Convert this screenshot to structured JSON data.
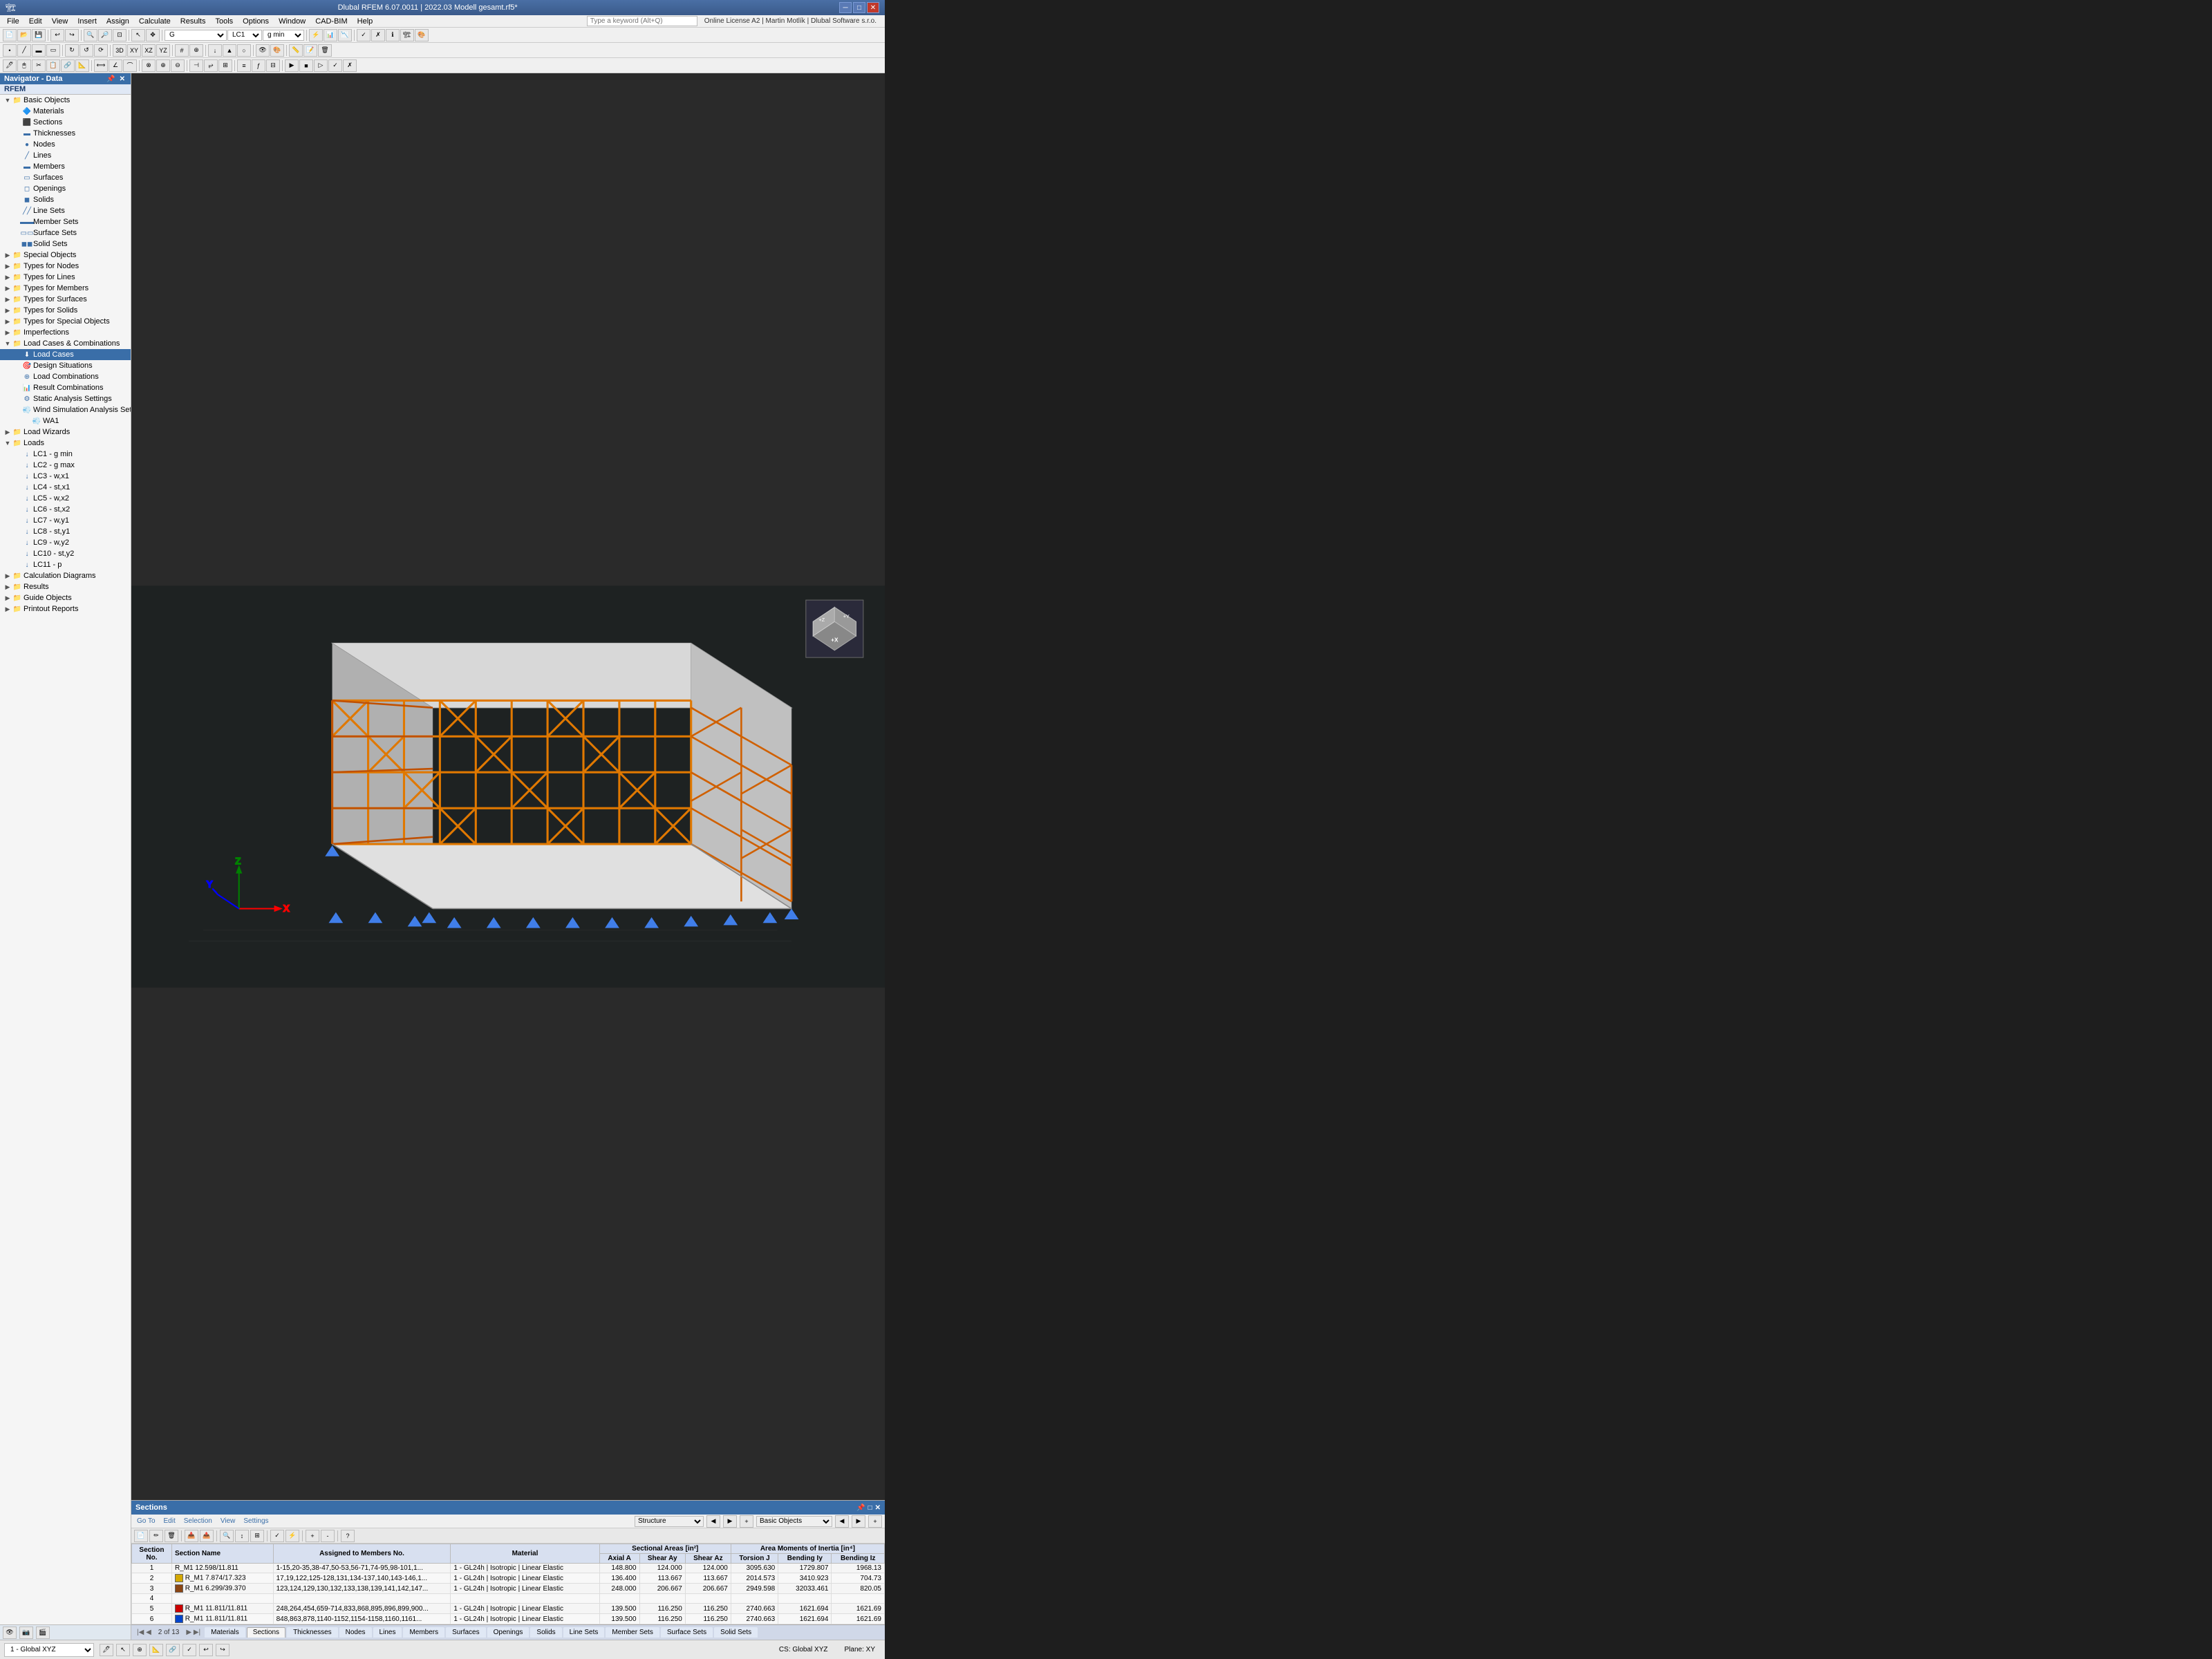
{
  "titleBar": {
    "title": "Dlubal RFEM 6.07.0011 | 2022.03 Modell gesamt.rf5*",
    "minimize": "─",
    "maximize": "□",
    "close": "✕"
  },
  "menuBar": {
    "items": [
      "File",
      "Edit",
      "View",
      "Insert",
      "Assign",
      "Calculate",
      "Results",
      "Tools",
      "Options",
      "Window",
      "CAD-BIM",
      "Help"
    ]
  },
  "toolbar1": {
    "dropdowns": [
      "G",
      "LC1",
      "g min"
    ],
    "search_placeholder": "Type a keyword (Alt+Q)",
    "license": "Online License A2 | Martin Motlík | Dlubal Software s.r.o."
  },
  "navigator": {
    "title": "Navigator - Data",
    "subtitle": "RFEM",
    "file": "2022.03 Modell gesamt.rf5*",
    "tree": [
      {
        "id": "basic-objects",
        "level": 1,
        "label": "Basic Objects",
        "expanded": true,
        "icon": "folder"
      },
      {
        "id": "materials",
        "level": 2,
        "label": "Materials",
        "icon": "material"
      },
      {
        "id": "sections",
        "level": 2,
        "label": "Sections",
        "icon": "section"
      },
      {
        "id": "thicknesses",
        "level": 2,
        "label": "Thicknesses",
        "icon": "thickness"
      },
      {
        "id": "nodes",
        "level": 2,
        "label": "Nodes",
        "icon": "node"
      },
      {
        "id": "lines",
        "level": 2,
        "label": "Lines",
        "icon": "line"
      },
      {
        "id": "members",
        "level": 2,
        "label": "Members",
        "icon": "member"
      },
      {
        "id": "surfaces",
        "level": 2,
        "label": "Surfaces",
        "icon": "surface"
      },
      {
        "id": "openings",
        "level": 2,
        "label": "Openings",
        "icon": "opening"
      },
      {
        "id": "solids",
        "level": 2,
        "label": "Solids",
        "icon": "solid"
      },
      {
        "id": "line-sets",
        "level": 2,
        "label": "Line Sets",
        "icon": "lineset"
      },
      {
        "id": "member-sets",
        "level": 2,
        "label": "Member Sets",
        "icon": "memberset"
      },
      {
        "id": "surface-sets",
        "level": 2,
        "label": "Surface Sets",
        "icon": "surfaceset"
      },
      {
        "id": "solid-sets",
        "level": 2,
        "label": "Solid Sets",
        "icon": "solidset"
      },
      {
        "id": "special-objects",
        "level": 1,
        "label": "Special Objects",
        "expanded": false,
        "icon": "folder"
      },
      {
        "id": "types-nodes",
        "level": 1,
        "label": "Types for Nodes",
        "expanded": false,
        "icon": "folder"
      },
      {
        "id": "types-lines",
        "level": 1,
        "label": "Types for Lines",
        "expanded": false,
        "icon": "folder"
      },
      {
        "id": "types-members",
        "level": 1,
        "label": "Types for Members",
        "expanded": false,
        "icon": "folder"
      },
      {
        "id": "types-surfaces",
        "level": 1,
        "label": "Types for Surfaces",
        "expanded": false,
        "icon": "folder"
      },
      {
        "id": "types-solids",
        "level": 1,
        "label": "Types for Solids",
        "expanded": false,
        "icon": "folder"
      },
      {
        "id": "types-special",
        "level": 1,
        "label": "Types for Special Objects",
        "expanded": false,
        "icon": "folder"
      },
      {
        "id": "imperfections",
        "level": 1,
        "label": "Imperfections",
        "expanded": false,
        "icon": "folder"
      },
      {
        "id": "load-cases-combo",
        "level": 1,
        "label": "Load Cases & Combinations",
        "expanded": true,
        "icon": "folder"
      },
      {
        "id": "load-cases",
        "level": 2,
        "label": "Load Cases",
        "icon": "loadcase",
        "selected": true
      },
      {
        "id": "design-situations",
        "level": 2,
        "label": "Design Situations",
        "icon": "design"
      },
      {
        "id": "load-combinations",
        "level": 2,
        "label": "Load Combinations",
        "icon": "combination"
      },
      {
        "id": "result-combinations",
        "level": 2,
        "label": "Result Combinations",
        "icon": "resultcombo"
      },
      {
        "id": "static-analysis",
        "level": 2,
        "label": "Static Analysis Settings",
        "icon": "settings"
      },
      {
        "id": "wind-simulation",
        "level": 2,
        "label": "Wind Simulation Analysis Settings",
        "icon": "wind"
      },
      {
        "id": "wa1",
        "level": 3,
        "label": "WA1",
        "icon": "wind"
      },
      {
        "id": "load-wizards",
        "level": 1,
        "label": "Load Wizards",
        "expanded": false,
        "icon": "folder"
      },
      {
        "id": "loads",
        "level": 1,
        "label": "Loads",
        "expanded": true,
        "icon": "folder"
      },
      {
        "id": "lc1",
        "level": 2,
        "label": "LC1 - g min",
        "icon": "load"
      },
      {
        "id": "lc2",
        "level": 2,
        "label": "LC2 - g max",
        "icon": "load"
      },
      {
        "id": "lc3",
        "level": 2,
        "label": "LC3 - w,x1",
        "icon": "load"
      },
      {
        "id": "lc4",
        "level": 2,
        "label": "LC4 - st,x1",
        "icon": "load"
      },
      {
        "id": "lc5",
        "level": 2,
        "label": "LC5 - w,x2",
        "icon": "load"
      },
      {
        "id": "lc6",
        "level": 2,
        "label": "LC6 - st,x2",
        "icon": "load"
      },
      {
        "id": "lc7",
        "level": 2,
        "label": "LC7 - w,y1",
        "icon": "load"
      },
      {
        "id": "lc8",
        "level": 2,
        "label": "LC8 - st,y1",
        "icon": "load"
      },
      {
        "id": "lc9",
        "level": 2,
        "label": "LC9 - w,y2",
        "icon": "load"
      },
      {
        "id": "lc10",
        "level": 2,
        "label": "LC10 - st,y2",
        "icon": "load"
      },
      {
        "id": "lc11",
        "level": 2,
        "label": "LC11 - p",
        "icon": "load"
      },
      {
        "id": "calc-diagrams",
        "level": 1,
        "label": "Calculation Diagrams",
        "expanded": false,
        "icon": "folder"
      },
      {
        "id": "results",
        "level": 1,
        "label": "Results",
        "expanded": false,
        "icon": "folder"
      },
      {
        "id": "guide-objects",
        "level": 1,
        "label": "Guide Objects",
        "expanded": false,
        "icon": "folder"
      },
      {
        "id": "printout-reports",
        "level": 1,
        "label": "Printout Reports",
        "expanded": false,
        "icon": "folder"
      }
    ]
  },
  "sectionsPanel": {
    "title": "Sections",
    "nav_items": [
      "Go To",
      "Edit",
      "Selection",
      "View",
      "Settings"
    ],
    "structure_combo": "Structure",
    "basic_objects_combo": "Basic Objects",
    "columns": {
      "main": [
        "Section No.",
        "Section Name",
        "Assigned to Members No.",
        "Material",
        "Axial A",
        "Shear Ay",
        "Shear Az",
        "Torsion J",
        "Bending Iy",
        "Bending Iz"
      ],
      "groups": [
        "Sectional Areas [in²]",
        "Area Moments of Inertia [in⁴]"
      ]
    },
    "rows": [
      {
        "no": 1,
        "name": "R_M1 12.598/11.811",
        "members": "1-15,20-35,38-47,50-53,56-71,74-95,98-101,1...",
        "material": "1 - GL24h | Isotropic | Linear Elastic",
        "axialA": "148.800",
        "shearAy": "124.000",
        "shearAz": "124.000",
        "torsionJ": "3095.630",
        "bendingIy": "1729.807",
        "bendingIz": "1968.13",
        "color": null
      },
      {
        "no": 2,
        "name": "R_M1 7.874/17.323",
        "members": "17,19,122,125-128,131,134-137,140,143-146,1...",
        "material": "1 - GL24h | Isotropic | Linear Elastic",
        "axialA": "136.400",
        "shearAy": "113.667",
        "shearAz": "113.667",
        "torsionJ": "2014.573",
        "bendingIy": "3410.923",
        "bendingIz": "704.73",
        "color": "#d4a800"
      },
      {
        "no": 3,
        "name": "R_M1 6.299/39.370",
        "members": "123,124,129,130,132,133,138,139,141,142,147...",
        "material": "1 - GL24h | Isotropic | Linear Elastic",
        "axialA": "248.000",
        "shearAy": "206.667",
        "shearAz": "206.667",
        "torsionJ": "2949.598",
        "bendingIy": "32033.461",
        "bendingIz": "820.05",
        "color": "#8b4513"
      },
      {
        "no": 4,
        "name": "",
        "members": "",
        "material": "",
        "axialA": "",
        "shearAy": "",
        "shearAz": "",
        "torsionJ": "",
        "bendingIy": "",
        "bendingIz": "",
        "color": null
      },
      {
        "no": 5,
        "name": "R_M1 11.811/11.811",
        "members": "248,264,454,659-714,833,868,895,896,899,900...",
        "material": "1 - GL24h | Isotropic | Linear Elastic",
        "axialA": "139.500",
        "shearAy": "116.250",
        "shearAz": "116.250",
        "torsionJ": "2740.663",
        "bendingIy": "1621.694",
        "bendingIz": "1621.69",
        "color": "#cc0000"
      },
      {
        "no": 6,
        "name": "R_M1 11.811/11.811",
        "members": "848,863,878,1140-1152,1154-1158,1160,1161...",
        "material": "1 - GL24h | Isotropic | Linear Elastic",
        "axialA": "139.500",
        "shearAy": "116.250",
        "shearAz": "116.250",
        "torsionJ": "2740.663",
        "bendingIy": "1621.694",
        "bendingIz": "1621.69",
        "color": "#0044cc"
      }
    ]
  },
  "bottomTabs": [
    "Materials",
    "Sections",
    "Thicknesses",
    "Nodes",
    "Lines",
    "Members",
    "Surfaces",
    "Openings",
    "Solids",
    "Line Sets",
    "Member Sets",
    "Surface Sets",
    "Solid Sets"
  ],
  "activeTab": "Sections",
  "paginationInfo": "2 of 13",
  "statusBar": {
    "view": "1 - Global XYZ",
    "cs": "CS: Global XYZ",
    "plane": "Plane: XY"
  }
}
